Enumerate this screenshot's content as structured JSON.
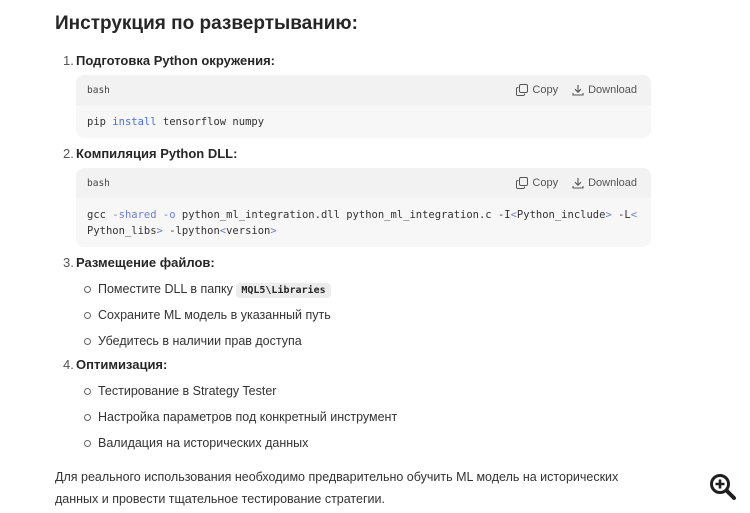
{
  "heading": "Инструкция по развертыванию:",
  "steps": [
    {
      "num": "1.",
      "title": "Подготовка Python окружения:",
      "code": {
        "lang": "bash",
        "copy_label": "Copy",
        "download_label": "Download",
        "tokens": [
          {
            "t": "pip ",
            "c": ""
          },
          {
            "t": "install",
            "c": "kw"
          },
          {
            "t": " tensorflow numpy",
            "c": ""
          }
        ]
      }
    },
    {
      "num": "2.",
      "title": "Компиляция Python DLL:",
      "code": {
        "lang": "bash",
        "copy_label": "Copy",
        "download_label": "Download",
        "tokens": [
          {
            "t": "gcc ",
            "c": ""
          },
          {
            "t": "-shared",
            "c": "op"
          },
          {
            "t": " ",
            "c": ""
          },
          {
            "t": "-o",
            "c": "op"
          },
          {
            "t": " python_ml_integration.dll python_ml_integration.c -I",
            "c": ""
          },
          {
            "t": "<",
            "c": "op"
          },
          {
            "t": "Python_include",
            "c": ""
          },
          {
            "t": ">",
            "c": "op"
          },
          {
            "t": " -L",
            "c": ""
          },
          {
            "t": "<",
            "c": "op"
          },
          {
            "t": "Python_libs",
            "c": ""
          },
          {
            "t": ">",
            "c": "op"
          },
          {
            "t": " -lpython",
            "c": ""
          },
          {
            "t": "<",
            "c": "op"
          },
          {
            "t": "version",
            "c": ""
          },
          {
            "t": ">",
            "c": "op"
          }
        ]
      }
    },
    {
      "num": "3.",
      "title": "Размещение файлов:",
      "items": [
        {
          "text": "Поместите DLL в папку ",
          "code": "MQL5\\Libraries"
        },
        {
          "text": "Сохраните ML модель в указанный путь"
        },
        {
          "text": "Убедитесь в наличии прав доступа"
        }
      ]
    },
    {
      "num": "4.",
      "title": "Оптимизация:",
      "items": [
        {
          "text": "Тестирование в Strategy Tester"
        },
        {
          "text": "Настройка параметров под конкретный инструмент"
        },
        {
          "text": "Валидация на исторических данных"
        }
      ]
    }
  ],
  "footer": "Для реального использования необходимо предварительно обучить ML модель на исторических данных и провести тщательное тестирование стратегии.",
  "icons": {
    "copy": "copy-icon",
    "download": "download-icon",
    "zoom": "zoom-in-icon"
  },
  "colors": {
    "keyword": "#4a6ee0",
    "operator": "#6e7fd1",
    "code_bg": "#f7f7f8"
  }
}
